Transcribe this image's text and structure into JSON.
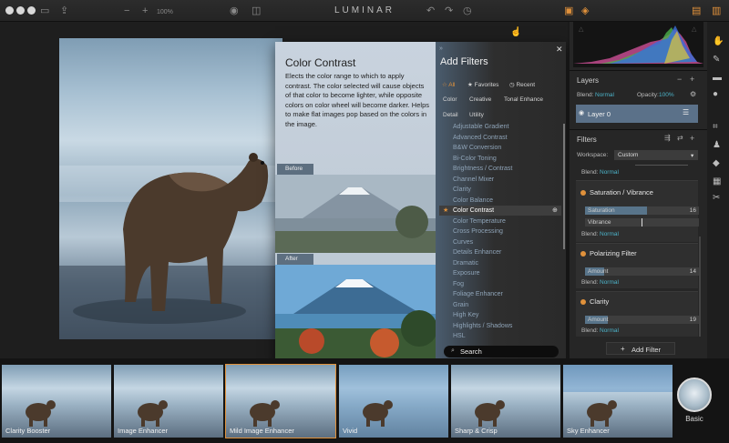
{
  "app": {
    "title": "LUMINAR",
    "zoom": "100%"
  },
  "popup": {
    "filter_title": "Color Contrast",
    "filter_description": "Elects the color range to which to apply contrast. The color selected will cause objects of that color to become lighter, while opposite colors on color wheel will become darker. Helps to make flat images pop based on the colors in the image.",
    "before_label": "Before",
    "after_label": "After",
    "add_filters_title": "Add Filters",
    "categories": [
      "All",
      "Favorites",
      "Recent",
      "Color",
      "Creative",
      "Tonal Enhance",
      "Detail",
      "Utility"
    ],
    "filters": [
      "Adjustable Gradient",
      "Advanced Contrast",
      "B&W Conversion",
      "Bi-Color Toning",
      "Brightness / Contrast",
      "Channel Mixer",
      "Clarity",
      "Color Balance",
      "Color Contrast",
      "Color Temperature",
      "Cross Processing",
      "Curves",
      "Details Enhancer",
      "Dramatic",
      "Exposure",
      "Fog",
      "Foliage Enhancer",
      "Grain",
      "High Key",
      "Highlights / Shadows",
      "HSL"
    ],
    "selected_filter": "Color Contrast",
    "search_placeholder": "Search"
  },
  "layers": {
    "title": "Layers",
    "blend_label": "Blend:",
    "blend_value": "Normal",
    "opacity_label": "Opacity:",
    "opacity_value": "100%",
    "layer_name": "Layer 0"
  },
  "filters_panel": {
    "title": "Filters",
    "workspace_label": "Workspace:",
    "workspace_value": "Custom",
    "blend_label": "Blend:",
    "blend_value": "Normal",
    "items": [
      {
        "name": "Saturation / Vibrance",
        "sliders": [
          {
            "label": "Saturation",
            "value": "16",
            "fraction": 0.54
          },
          {
            "label": "Vibrance",
            "value": "",
            "fraction": 0.5
          }
        ],
        "blend": "Normal"
      },
      {
        "name": "Polarizing Filter",
        "sliders": [
          {
            "label": "Amount",
            "value": "14",
            "fraction": 0.17
          }
        ],
        "blend": "Normal"
      },
      {
        "name": "Clarity",
        "sliders": [
          {
            "label": "Amount",
            "value": "19",
            "fraction": 0.2
          }
        ],
        "blend": "Normal"
      }
    ],
    "add_filter_label": "Add Filter"
  },
  "presets": [
    "Clarity Booster",
    "Image Enhancer",
    "Mild Image Enhancer",
    "Vivid",
    "Sharp & Crisp",
    "Sky Enhancer"
  ],
  "active_preset": "Mild Image Enhancer",
  "preset_category": "Basic",
  "colors": {
    "accent": "#e0913b",
    "teal": "#4cb3c9",
    "layer_selected": "#5b7189"
  }
}
